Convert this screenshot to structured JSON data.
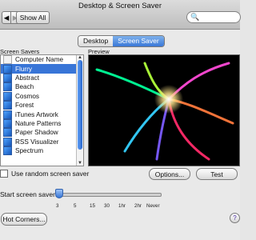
{
  "window": {
    "title": "Desktop & Screen Saver"
  },
  "toolbar": {
    "back": "◀",
    "forward": "▶",
    "show_all_label": "Show All",
    "search": {
      "placeholder": ""
    }
  },
  "tabs": [
    {
      "label": "Desktop"
    },
    {
      "label": "Screen Saver"
    }
  ],
  "labels": {
    "screen_savers": "Screen Savers",
    "preview": "Preview"
  },
  "list": {
    "items": [
      {
        "label": "Computer Name",
        "selected": false
      },
      {
        "label": "Flurry",
        "selected": true
      },
      {
        "label": "Abstract",
        "selected": false
      },
      {
        "label": "Beach",
        "selected": false
      },
      {
        "label": "Cosmos",
        "selected": false
      },
      {
        "label": "Forest",
        "selected": false
      },
      {
        "label": "iTunes Artwork",
        "selected": false
      },
      {
        "label": "Nature Patterns",
        "selected": false
      },
      {
        "label": "Paper Shadow",
        "selected": false
      },
      {
        "label": "RSS Visualizer",
        "selected": false
      },
      {
        "label": "Spectrum",
        "selected": false
      }
    ]
  },
  "random": {
    "label": "Use random screen saver",
    "checked": false
  },
  "buttons": {
    "options": "Options...",
    "test": "Test",
    "hot_corners": "Hot Corners..."
  },
  "start": {
    "label": "Start screen saver:",
    "ticks": [
      "3",
      "5",
      "15",
      "30",
      "1hr",
      "2hr",
      "Never"
    ],
    "selected_index": 0
  },
  "help": {
    "glyph": "?"
  }
}
